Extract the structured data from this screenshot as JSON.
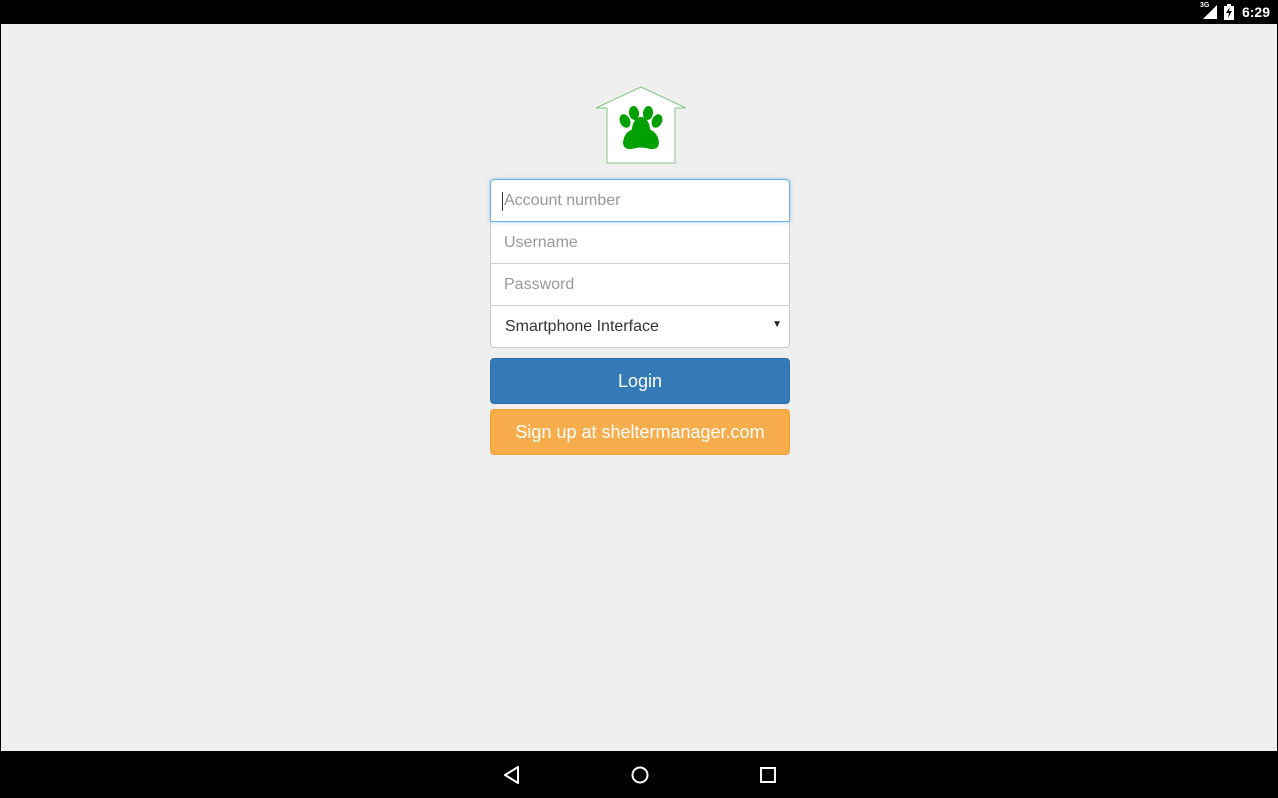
{
  "status_bar": {
    "network_label": "3G",
    "time": "6:29"
  },
  "app": {
    "logo_icon": "house-paw-icon",
    "accent_color": "#00a000"
  },
  "login_form": {
    "account_placeholder": "Account number",
    "username_placeholder": "Username",
    "password_placeholder": "Password",
    "interface_selected": "Smartphone Interface",
    "login_label": "Login",
    "signup_label": "Sign up at sheltermanager.com"
  },
  "colors": {
    "login_button": "#337ab7",
    "signup_button": "#f8ad4c",
    "focus_border": "#66afe9"
  },
  "nav_bar": {
    "back_icon": "back-triangle-icon",
    "home_icon": "home-circle-icon",
    "recents_icon": "recents-square-icon"
  }
}
